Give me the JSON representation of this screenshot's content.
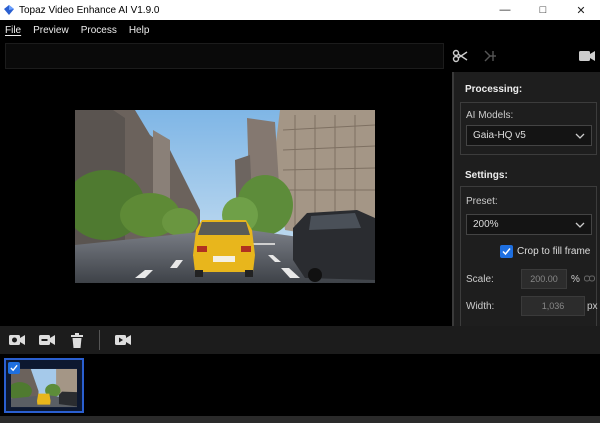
{
  "window": {
    "title": "Topaz Video Enhance AI V1.9.0",
    "controls": [
      "minimize",
      "maximize",
      "close"
    ]
  },
  "menu": [
    {
      "label": "File"
    },
    {
      "label": "Preview"
    },
    {
      "label": "Process"
    },
    {
      "label": "Help"
    }
  ],
  "toolbar": {
    "path_value": "",
    "icons": [
      "scissors-icon",
      "split-icon",
      "camera-icon"
    ]
  },
  "panel": {
    "processing_heading": "Processing:",
    "ai_models_label": "AI Models:",
    "ai_model_value": "Gaia-HQ v5",
    "settings_heading": "Settings:",
    "preset_label": "Preset:",
    "preset_value": "200%",
    "crop_label": "Crop to fill frame",
    "crop_checked": true,
    "scale_label": "Scale:",
    "scale_value": "200.00",
    "scale_unit": "%",
    "width_label": "Width:",
    "width_value": "1,036",
    "width_unit": "px"
  },
  "bottom_toolbar": {
    "icons": [
      "add-video-icon",
      "remove-video-icon",
      "trash-icon",
      "preview-video-icon"
    ]
  },
  "colors": {
    "accent": "#1e6fe0",
    "panel_bg": "#1e1e1e",
    "taxi": "#e8b61c"
  }
}
